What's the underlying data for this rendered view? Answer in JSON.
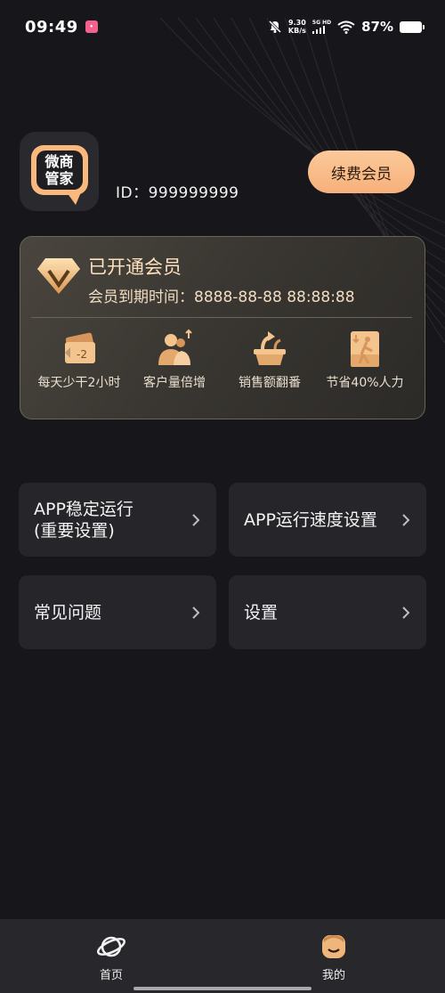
{
  "status_bar": {
    "time": "09:49",
    "net_speed_value": "9.30",
    "net_speed_unit": "KB/s",
    "signal_label": "5G HD",
    "battery": "87%"
  },
  "profile": {
    "logo_text": "微商\n管家",
    "id_text": "ID：999999999",
    "renew_label": "续费会员"
  },
  "vip": {
    "title": "已开通会员",
    "expiry": "会员到期时间：8888-88-88 88:88:88",
    "benefits": [
      {
        "label": "每天少干2小时",
        "icon": "time-card-icon"
      },
      {
        "label": "客户量倍增",
        "icon": "customers-up-icon"
      },
      {
        "label": "销售额翻番",
        "icon": "sales-up-icon"
      },
      {
        "label": "节省40%人力",
        "icon": "save-labor-icon"
      }
    ]
  },
  "menu": {
    "stable_run": "APP稳定运行\n(重要设置)",
    "speed_settings": "APP运行速度设置",
    "faq": "常见问题",
    "settings": "设置"
  },
  "nav": {
    "home": "首页",
    "mine": "我的"
  },
  "colors": {
    "background": "#17171b",
    "accent": "#f6b07a",
    "card": "#26262a"
  }
}
